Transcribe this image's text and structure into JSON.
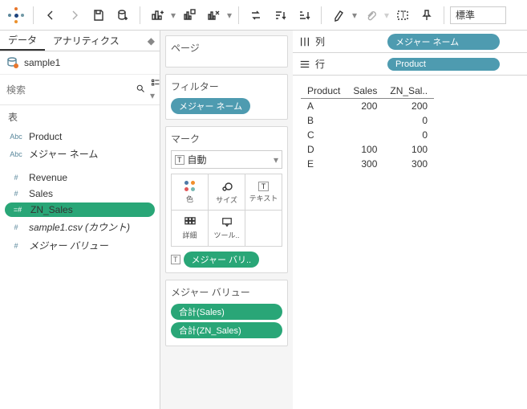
{
  "toolbar": {
    "standard": "標準"
  },
  "tabs": {
    "data": "データ",
    "analytics": "アナリティクス"
  },
  "datasource": "sample1",
  "search": {
    "placeholder": "検索"
  },
  "sections": {
    "tables": "表"
  },
  "fields": {
    "abc": "Abc",
    "num": "#",
    "product": "Product",
    "measure_names": "メジャー ネーム",
    "revenue": "Revenue",
    "sales": "Sales",
    "zn_sales": "ZN_Sales",
    "count": "sample1.csv (カウント)",
    "measure_values": "メジャー バリュー"
  },
  "cards": {
    "pages": "ページ",
    "filters": "フィルター",
    "marks": "マーク",
    "marks_auto": "自動",
    "color": "色",
    "size": "サイズ",
    "text": "テキスト",
    "detail": "詳細",
    "tooltip": "ツール..",
    "measure_values_pill": "メジャー バリ..",
    "measure_values_title": "メジャー バリュー",
    "agg_sales": "合計(Sales)",
    "agg_zn": "合計(ZN_Sales)"
  },
  "shelves": {
    "columns": "列",
    "rows": "行",
    "columns_pill": "メジャー ネーム",
    "rows_pill": "Product"
  },
  "chart_data": {
    "type": "table",
    "columns": [
      "Product",
      "Sales",
      "ZN_Sal.."
    ],
    "rows": [
      {
        "Product": "A",
        "Sales": 200,
        "ZN": 200
      },
      {
        "Product": "B",
        "Sales": "",
        "ZN": 0
      },
      {
        "Product": "C",
        "Sales": "",
        "ZN": 0
      },
      {
        "Product": "D",
        "Sales": 100,
        "ZN": 100
      },
      {
        "Product": "E",
        "Sales": 300,
        "ZN": 300
      }
    ]
  }
}
